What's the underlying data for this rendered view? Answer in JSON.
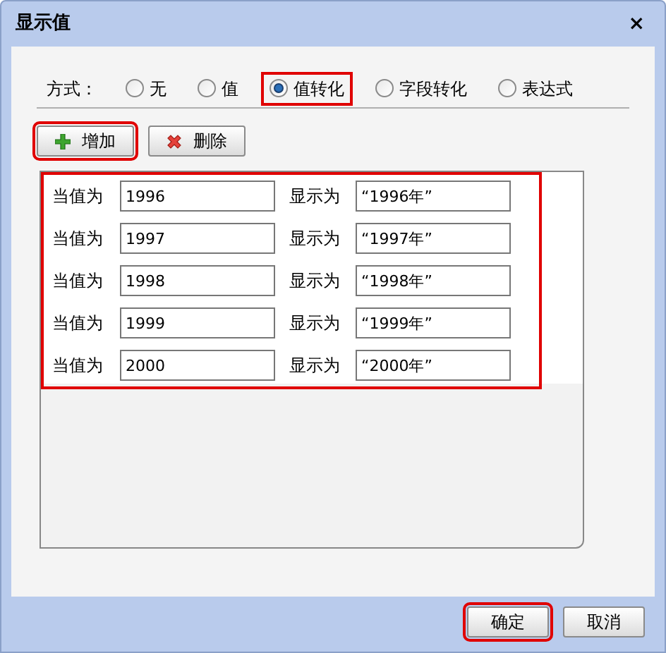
{
  "window": {
    "title": "显示值",
    "close": "×"
  },
  "mode": {
    "label": "方式：",
    "options": [
      {
        "label": "无",
        "selected": false,
        "highlighted": false
      },
      {
        "label": "值",
        "selected": false,
        "highlighted": false
      },
      {
        "label": "值转化",
        "selected": true,
        "highlighted": true
      },
      {
        "label": "字段转化",
        "selected": false,
        "highlighted": false
      },
      {
        "label": "表达式",
        "selected": false,
        "highlighted": false
      }
    ]
  },
  "toolbar": [
    {
      "kind": "add",
      "label": "增加",
      "highlighted": true
    },
    {
      "kind": "delete",
      "label": "删除",
      "highlighted": false
    }
  ],
  "rows_highlighted": true,
  "rows": [
    {
      "when_label": "当值为",
      "value": "1996",
      "show_label": "显示为",
      "display": "“1996年”"
    },
    {
      "when_label": "当值为",
      "value": "1997",
      "show_label": "显示为",
      "display": "“1997年”"
    },
    {
      "when_label": "当值为",
      "value": "1998",
      "show_label": "显示为",
      "display": "“1998年”"
    },
    {
      "when_label": "当值为",
      "value": "1999",
      "show_label": "显示为",
      "display": "“1999年”"
    },
    {
      "when_label": "当值为",
      "value": "2000",
      "show_label": "显示为",
      "display": "“2000年”"
    }
  ],
  "buttons": [
    {
      "label": "确定",
      "highlighted": true
    },
    {
      "label": "取消",
      "highlighted": false
    }
  ]
}
